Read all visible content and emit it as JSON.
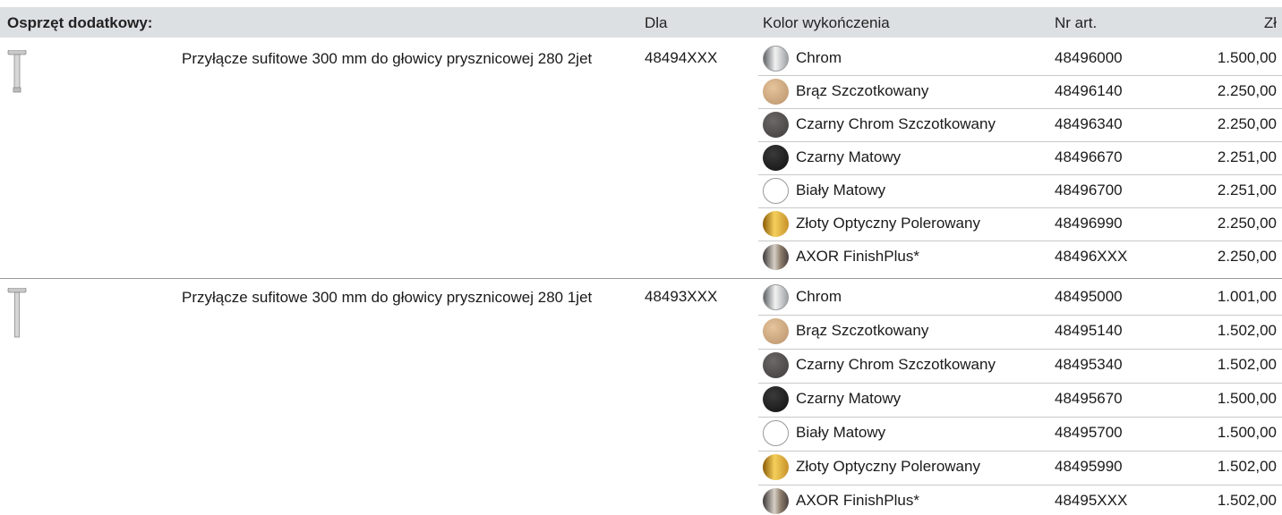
{
  "header": {
    "section": "Osprzęt dodatkowy:",
    "dla": "Dla",
    "kolor": "Kolor wykończenia",
    "nr": "Nr art.",
    "zl": "Zł"
  },
  "products": [
    {
      "name": "Przyłącze sufitowe 300 mm do głowicy prysznicowej 280 2jet",
      "for": "48494XXX",
      "variants": [
        {
          "finish": "Chrom",
          "swatch": "chrome",
          "nr": "48496000",
          "price": "1.500,00"
        },
        {
          "finish": "Brąz Szczotkowany",
          "swatch": "bronze",
          "nr": "48496140",
          "price": "2.250,00"
        },
        {
          "finish": "Czarny Chrom Szczotkowany",
          "swatch": "blackchrome",
          "nr": "48496340",
          "price": "2.250,00"
        },
        {
          "finish": "Czarny Matowy",
          "swatch": "black",
          "nr": "48496670",
          "price": "2.251,00"
        },
        {
          "finish": "Biały Matowy",
          "swatch": "white",
          "nr": "48496700",
          "price": "2.251,00"
        },
        {
          "finish": "Złoty Optyczny Polerowany",
          "swatch": "gold",
          "nr": "48496990",
          "price": "2.250,00"
        },
        {
          "finish": "AXOR FinishPlus*",
          "swatch": "finishplus",
          "nr": "48496XXX",
          "price": "2.250,00"
        }
      ]
    },
    {
      "name": "Przyłącze sufitowe 300 mm do głowicy prysznicowej 280 1jet",
      "for": "48493XXX",
      "variants": [
        {
          "finish": "Chrom",
          "swatch": "chrome",
          "nr": "48495000",
          "price": "1.001,00"
        },
        {
          "finish": "Brąz Szczotkowany",
          "swatch": "bronze",
          "nr": "48495140",
          "price": "1.502,00"
        },
        {
          "finish": "Czarny Chrom Szczotkowany",
          "swatch": "blackchrome",
          "nr": "48495340",
          "price": "1.502,00"
        },
        {
          "finish": "Czarny Matowy",
          "swatch": "black",
          "nr": "48495670",
          "price": "1.500,00"
        },
        {
          "finish": "Biały Matowy",
          "swatch": "white",
          "nr": "48495700",
          "price": "1.500,00"
        },
        {
          "finish": "Złoty Optyczny Polerowany",
          "swatch": "gold",
          "nr": "48495990",
          "price": "1.502,00"
        },
        {
          "finish": "AXOR FinishPlus*",
          "swatch": "finishplus",
          "nr": "48495XXX",
          "price": "1.502,00"
        }
      ]
    }
  ]
}
